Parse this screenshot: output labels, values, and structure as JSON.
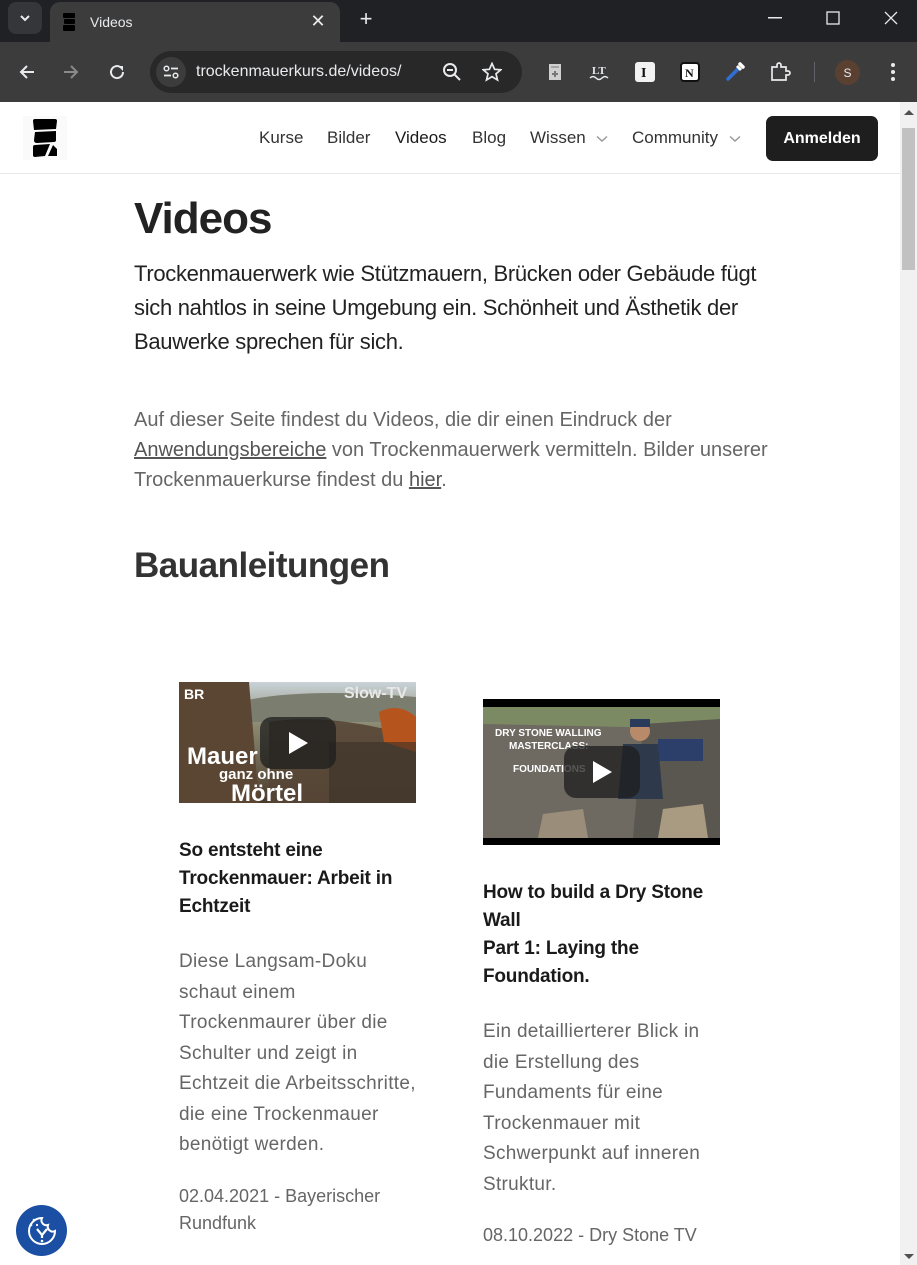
{
  "browser": {
    "tab_title": "Videos",
    "url": "trockenmauerkurs.de/videos/",
    "profile_initial": "S",
    "extensions": [
      "clipboard-extension-icon",
      "languagetool-icon",
      "instapaper-icon",
      "notion-icon",
      "color-picker-icon",
      "extensions-puzzle-icon"
    ]
  },
  "header": {
    "nav": [
      {
        "label": "Kurse"
      },
      {
        "label": "Bilder"
      },
      {
        "label": "Videos"
      },
      {
        "label": "Blog"
      },
      {
        "label": "Wissen",
        "dropdown": true
      },
      {
        "label": "Community",
        "dropdown": true
      }
    ],
    "login_label": "Anmelden"
  },
  "main": {
    "title": "Videos",
    "lead": "Trockenmauerwerk wie Stützmauern, Brücken oder Gebäude fügt sich nahtlos in seine Umgebung ein. Schönheit und Ästhetik der Bauwerke sprechen für sich.",
    "intro": {
      "part1": "Auf dieser Seite findest du Videos, die dir einen Eindruck der ",
      "link1": "Anwendungsbereiche",
      "part2": " von Trockenmauerwerk vermitteln. Bilder unserer Trockenmauerkurse findest du ",
      "link2": "hier",
      "part3": "."
    },
    "section_title": "Bauanleitungen",
    "videos": [
      {
        "thumb_text": {
          "brand": "BR",
          "corner": "Slow-TV",
          "line1": "Mauer",
          "line2": "ganz ohne",
          "line3": "Mörtel"
        },
        "title": "So entsteht eine Trockenmauer: Arbeit in Echtzeit",
        "description": "Diese Langsam-Doku schaut einem Trockenmaurer über die Schulter und zeigt in Echtzeit die Arbeitsschritte, die eine Trockenmauer benötigt werden.",
        "meta": "02.04.2021 - Bayerischer Rundfunk"
      },
      {
        "thumb_text": {
          "line1": "DRY STONE WALLING",
          "line2": "MASTERCLASS:",
          "line3": "FOUNDATIONS"
        },
        "title": "How to build a Dry Stone Wall\nPart 1: Laying the Foundation.",
        "description": "Ein detaillierterer Blick in die Erstellung des Fundaments für eine Trockenmauer mit Schwerpunkt auf inneren Struktur.",
        "meta": "08.10.2022 - Dry Stone TV"
      }
    ]
  },
  "colors": {
    "cookie_button": "#1a4fa3",
    "login_button": "#1e1e1e"
  }
}
